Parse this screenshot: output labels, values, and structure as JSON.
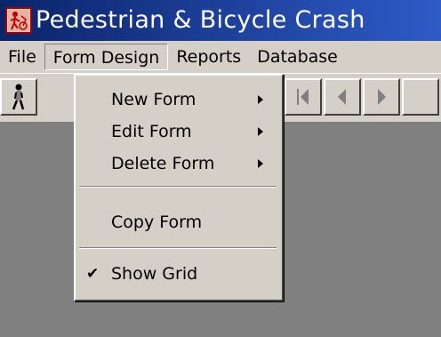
{
  "window": {
    "title": "Pedestrian & Bicycle Crash",
    "icon": "crash-app-icon"
  },
  "menubar": {
    "items": [
      {
        "label": "File"
      },
      {
        "label": "Form Design"
      },
      {
        "label": "Reports"
      },
      {
        "label": "Database"
      }
    ]
  },
  "toolbar": {
    "buttons": [
      {
        "icon": "pedestrian-icon"
      },
      {
        "icon": "first-record-icon"
      },
      {
        "icon": "previous-record-icon"
      },
      {
        "icon": "next-record-icon"
      }
    ]
  },
  "form_design_menu": {
    "items": [
      {
        "label": "New Form",
        "submenu": true
      },
      {
        "label": "Edit Form",
        "submenu": true
      },
      {
        "label": "Delete Form",
        "submenu": true
      },
      {
        "label": "Copy Form",
        "submenu": false
      },
      {
        "label": "Show Grid",
        "checked": true,
        "check_glyph": "✔"
      }
    ]
  },
  "colors": {
    "title_bar": "#0a246a",
    "menu_bg": "#d4d0c8",
    "workspace_bg": "#808080"
  }
}
